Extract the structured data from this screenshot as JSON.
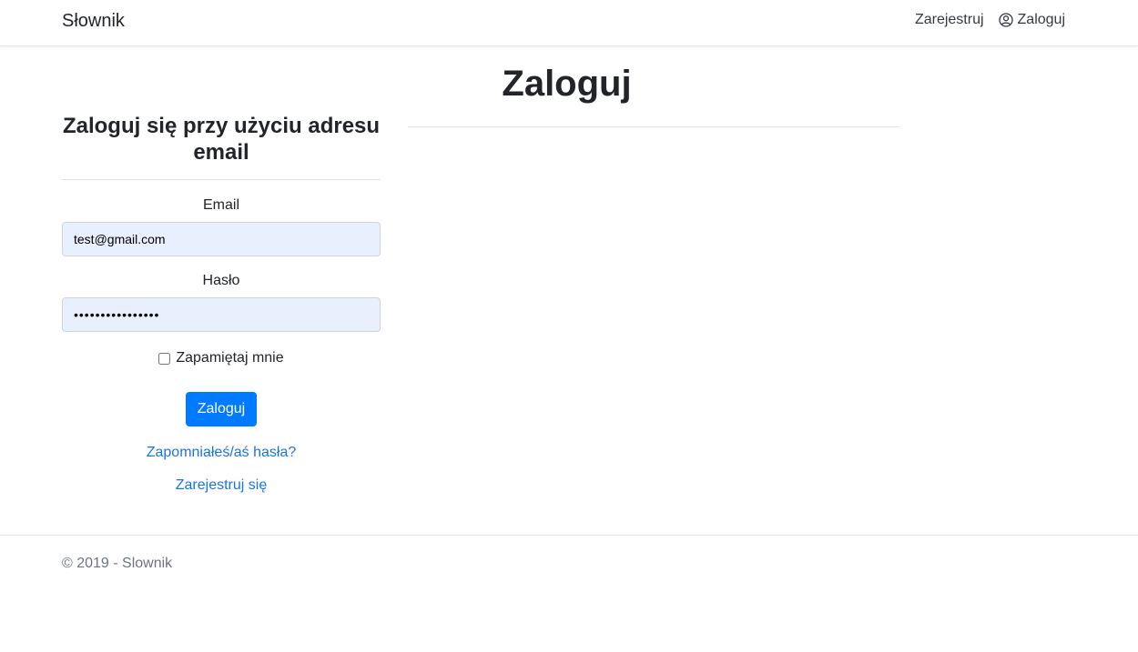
{
  "navbar": {
    "brand": "Słownik",
    "links": [
      {
        "label": "Zarejestruj"
      },
      {
        "label": "Zaloguj",
        "icon": "user-circle-icon"
      }
    ]
  },
  "page": {
    "title": "Zaloguj"
  },
  "login_form": {
    "heading": "Zaloguj się przy użyciu adresu email",
    "email_label": "Email",
    "email_value": "test@gmail.com",
    "password_label": "Hasło",
    "password_value": "••••••••••••••••",
    "remember_label": "Zapamiętaj mnie",
    "remember_checked": false,
    "submit_label": "Zaloguj",
    "forgot_link": "Zapomniałeś/aś hasła?",
    "register_link": "Zarejestruj się"
  },
  "footer": {
    "text": "© 2019 - Slownik"
  },
  "colors": {
    "primary": "#007bff",
    "link": "#1a73e8",
    "autofill_bg": "#e8f0fe",
    "footer_text": "#6c757d"
  }
}
